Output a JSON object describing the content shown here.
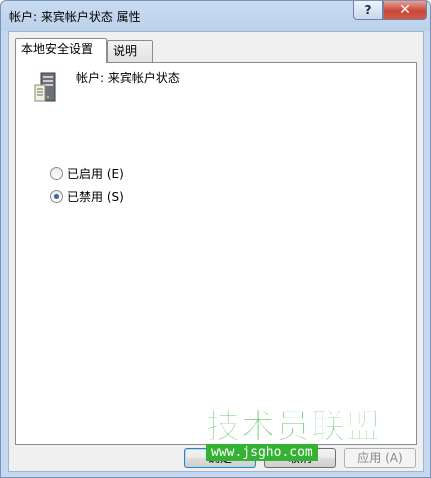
{
  "window": {
    "title": "帐户: 来宾帐户状态 属性",
    "help_label": "?",
    "close_label": "✕"
  },
  "tabs": [
    {
      "label": "本地安全设置",
      "active": true
    },
    {
      "label": "说明",
      "active": false
    }
  ],
  "panel": {
    "icon": "server-icon",
    "account_label": "帐户: 来宾帐户状态",
    "options": [
      {
        "label": "已启用 (E)",
        "checked": false
      },
      {
        "label": "已禁用 (S)",
        "checked": true
      }
    ]
  },
  "buttons": {
    "ok": "确定",
    "cancel": "取消",
    "apply": "应用 (A)"
  },
  "watermark": {
    "title": "技术员联盟",
    "url": "www.jsgho.com"
  },
  "colors": {
    "title_bar": "#c8dcf3",
    "close_button": "#c8473a",
    "watermark_green": "#33b233"
  }
}
